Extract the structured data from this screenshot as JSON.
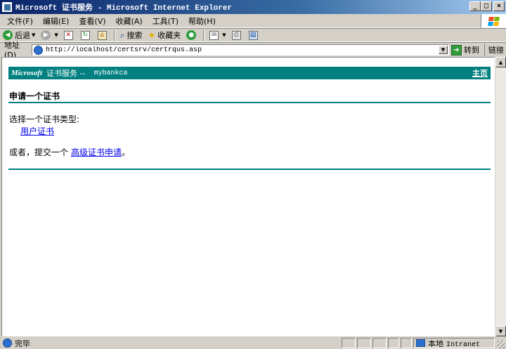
{
  "window": {
    "title": "Microsoft 证书服务 - Microsoft Internet Explorer",
    "buttons": {
      "minimize": "_",
      "maximize": "□",
      "close": "×"
    }
  },
  "menu": [
    "文件(F)",
    "编辑(E)",
    "查看(V)",
    "收藏(A)",
    "工具(T)",
    "帮助(H)"
  ],
  "toolbar": {
    "back_label": "后退",
    "search_label": "搜索",
    "favorites_label": "收藏夹"
  },
  "address": {
    "label": "地址(D)",
    "url": "http://localhost/certsrv/certrqus.asp",
    "go_label": "转到",
    "links_label": "链接"
  },
  "page": {
    "brand": "Microsoft",
    "service": "证书服务 --",
    "ca_name": "mybankca",
    "home_link": "主页",
    "heading": "申请一个证书",
    "choose_type": "选择一个证书类型:",
    "user_cert_link": "用户证书",
    "or_text": "或者，提交一个",
    "advanced_link": "高级证书申请",
    "period": "。"
  },
  "status": {
    "text": "完毕",
    "zone_prefix": "本地",
    "zone_name": "Intranet"
  },
  "colors": {
    "accent": "#008080",
    "titlebar": "#0a246a",
    "link": "#0000ee"
  }
}
